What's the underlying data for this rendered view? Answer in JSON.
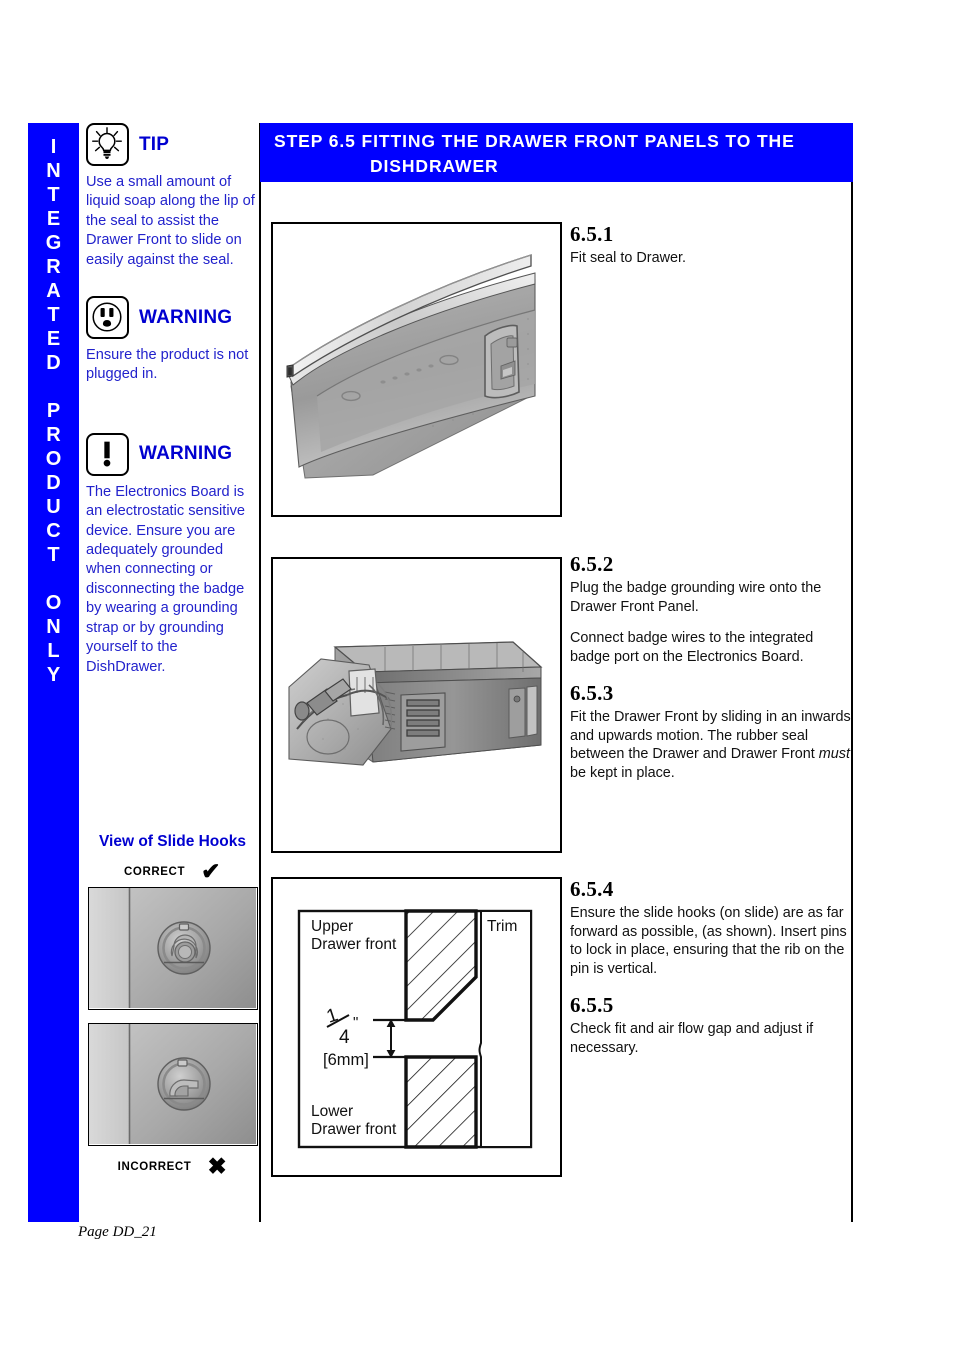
{
  "colors": {
    "brand_blue": "#0000ff",
    "note_text_blue": "#2222cc",
    "heading_blue": "#0000d0",
    "black": "#000000",
    "white": "#ffffff"
  },
  "side_tab": {
    "text": "INTEGRATED PRODUCT ONLY",
    "letters": [
      "I",
      "N",
      "T",
      "E",
      "G",
      "R",
      "A",
      "T",
      "E",
      "D",
      "",
      "P",
      "R",
      "O",
      "D",
      "U",
      "C",
      "T",
      "",
      "O",
      "N",
      "L",
      "Y"
    ]
  },
  "notes": [
    {
      "icon": "lightbulb-icon",
      "title": "TIP",
      "body": "Use a small amount of liquid soap along the lip of the seal to assist the Drawer Front to slide on easily against the seal."
    },
    {
      "icon": "power-outlet-icon",
      "title": "WARNING",
      "body": "Ensure the product is not plugged in."
    },
    {
      "icon": "exclamation-icon",
      "title": "WARNING",
      "body": "The Electronics Board is an electrostatic sensitive device.  Ensure you are adequately grounded when connecting or disconnecting the badge by wearing a grounding strap or by grounding yourself to the DishDrawer."
    }
  ],
  "slide_hooks": {
    "title": "View of Slide Hooks",
    "correct_label": "CORRECT",
    "correct_mark": "✔",
    "incorrect_label": "INCORRECT",
    "incorrect_mark": "✖",
    "correct_image_alt": "slide-hook-correct-orientation",
    "incorrect_image_alt": "slide-hook-incorrect-orientation"
  },
  "banner": {
    "line1": "STEP  6.5   FITTING  THE  DRAWER FRONT PANELS  TO THE",
    "line2": "DISHDRAWER"
  },
  "figures": [
    {
      "name": "drawer-seal-illustration",
      "alt": "Drawer top with seal strip being fitted"
    },
    {
      "name": "badge-wiring-illustration",
      "alt": "Drawer tub showing badge grounding wire and electronics board"
    },
    {
      "name": "airflow-gap-diagram",
      "alt": "Cross-section diagram of upper and lower drawer fronts with trim and gap"
    }
  ],
  "steps": [
    {
      "number": "6.5.1",
      "paragraphs": [
        "Fit seal to Drawer."
      ]
    },
    {
      "number": "6.5.2",
      "paragraphs": [
        "Plug the badge grounding wire onto the Drawer Front  Panel.",
        "Connect badge wires to the integrated badge port on the Electronics Board."
      ]
    },
    {
      "number": "6.5.3",
      "paragraphs_html": "Fit the Drawer Front by sliding in an inwards and upwards motion.  The rubber seal between the Drawer and Drawer Front <i>must</i> be kept in place."
    },
    {
      "number": "6.5.4",
      "paragraphs": [
        "Ensure the slide hooks (on slide) are as far forward as possible, (as shown). Insert pins to lock in place, ensuring that the rib on the pin is vertical."
      ]
    },
    {
      "number": "6.5.5",
      "paragraphs": [
        "Check fit and air flow gap and adjust if necessary."
      ]
    }
  ],
  "diagram_labels": {
    "upper_line1": "Upper",
    "upper_line2": "Drawer front",
    "lower_line1": "Lower",
    "lower_line2": "Drawer front",
    "trim": "Trim",
    "dim_fraction_num": "1",
    "dim_fraction_den": "4",
    "dim_unit": "\"",
    "dim_metric": "[6mm]"
  },
  "footer": {
    "page_label": "Page DD_21"
  }
}
